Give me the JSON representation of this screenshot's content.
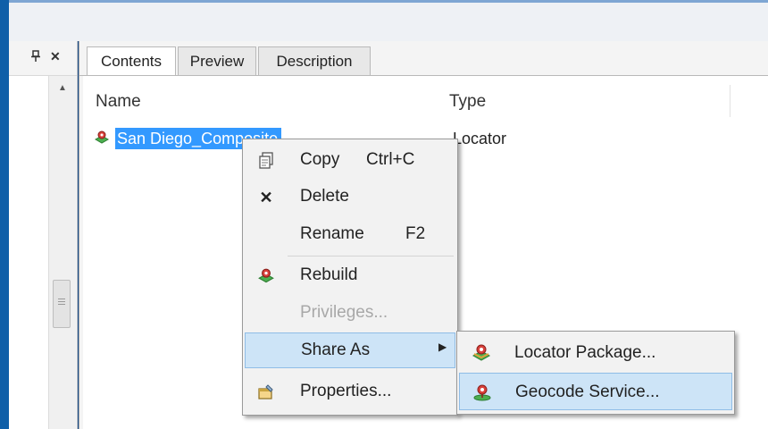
{
  "tabs": [
    {
      "label": "Contents",
      "active": true
    },
    {
      "label": "Preview",
      "active": false
    },
    {
      "label": "Description",
      "active": false
    }
  ],
  "columns": {
    "name": "Name",
    "type": "Type"
  },
  "item": {
    "name": "San Diego_Composite",
    "type": "Locator",
    "icon": "locator-icon"
  },
  "context_menu": [
    {
      "label": "Copy",
      "shortcut": "Ctrl+C",
      "icon": "copy-icon"
    },
    {
      "label": "Delete",
      "shortcut": "",
      "icon": "delete-icon"
    },
    {
      "label": "Rename",
      "shortcut": "F2",
      "icon": ""
    },
    {
      "label": "Rebuild",
      "shortcut": "",
      "icon": "rebuild-icon"
    },
    {
      "label": "Privileges...",
      "shortcut": "",
      "icon": "",
      "disabled": true
    },
    {
      "label": "Share As",
      "shortcut": "",
      "icon": "",
      "has_submenu": true,
      "highlighted": true
    },
    {
      "label": "Properties...",
      "shortcut": "",
      "icon": "properties-icon"
    }
  ],
  "submenu": [
    {
      "label": "Locator Package...",
      "icon": "locator-package-icon"
    },
    {
      "label": "Geocode Service...",
      "icon": "geocode-service-icon",
      "highlighted": true
    }
  ],
  "pane_buttons": {
    "pin": "pin-icon",
    "close": "close-icon"
  },
  "colors": {
    "selection": "#3399ff",
    "menu_highlight": "#cde4f7",
    "background": "#1a4f8f"
  }
}
